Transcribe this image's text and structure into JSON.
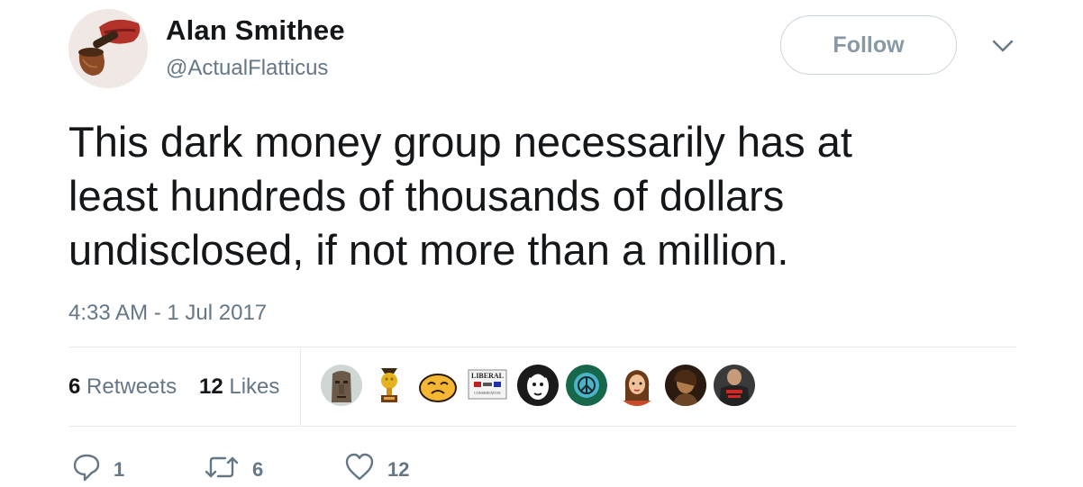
{
  "author": {
    "display_name": "Alan Smithee",
    "handle": "@ActualFlatticus",
    "avatar_icon": "pipe-smoking-lips-avatar"
  },
  "header": {
    "follow_label": "Follow",
    "menu_icon": "chevron-down-icon"
  },
  "tweet": {
    "text": "This dark money group necessarily has at\nleast hundreds of thousands of dollars\nundisclosed, if not more than a million.",
    "timestamp": "4:33 AM - 1 Jul 2017"
  },
  "stats": {
    "retweets_count": "6",
    "retweets_label": "Retweets",
    "likes_count": "12",
    "likes_label": "Likes"
  },
  "likers": {
    "badge_text": "LIBERAL",
    "badge_subtext": "CONSERVATIVE"
  },
  "actions": {
    "reply_count": "1",
    "retweet_count": "6",
    "like_count": "12"
  },
  "colors": {
    "text_primary": "#14171a",
    "text_secondary": "#657786",
    "border": "#e6ecf0",
    "follow_text": "#8899a6"
  }
}
